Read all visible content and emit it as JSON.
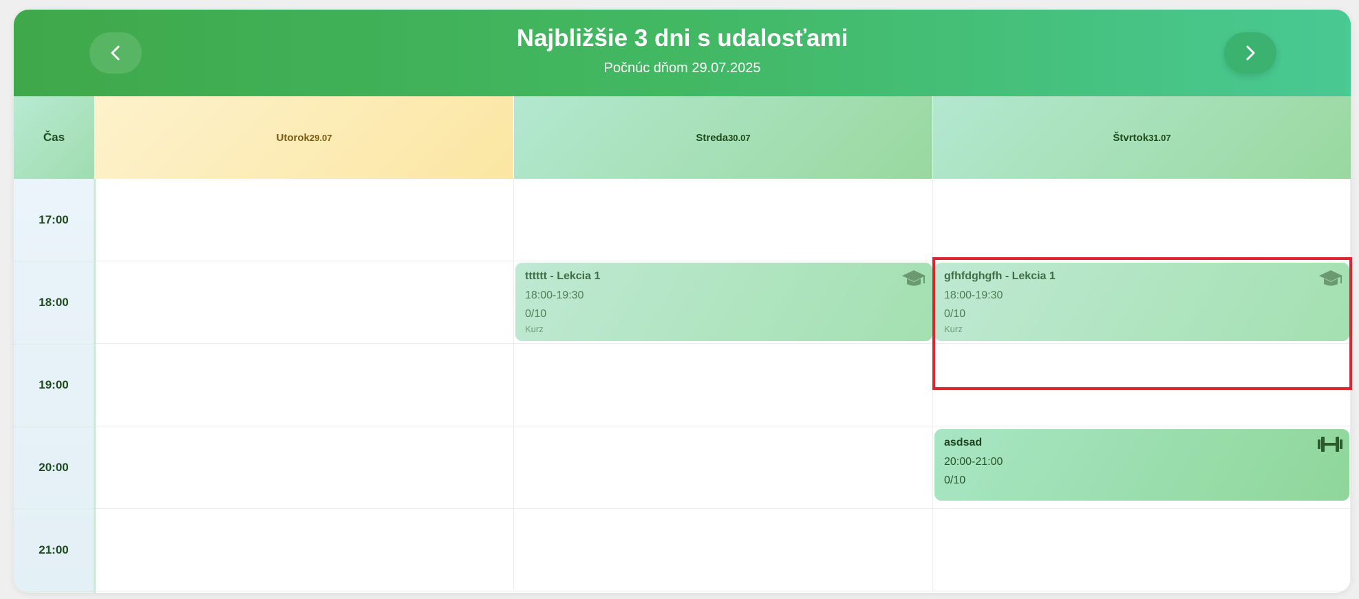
{
  "header": {
    "title": "Najbližšie 3 dni s udalosťami",
    "subtitle": "Počnúc dňom 29.07.2025",
    "prev_icon": "chevron-left-icon",
    "next_icon": "chevron-right-icon"
  },
  "columns": {
    "time_label": "Čas",
    "days": [
      {
        "name": "Utorok",
        "date": "29.07"
      },
      {
        "name": "Streda",
        "date": "30.07"
      },
      {
        "name": "Štvrtok",
        "date": "31.07"
      }
    ]
  },
  "times": [
    "17:00",
    "18:00",
    "19:00",
    "20:00",
    "21:00"
  ],
  "events": [
    {
      "title": "tttttt - Lekcia 1",
      "time": "18:00-19:30",
      "capacity": "0/10",
      "type": "Kurz",
      "icon": "graduation-cap-icon"
    },
    {
      "title": "gfhfdghgfh - Lekcia 1",
      "time": "18:00-19:30",
      "capacity": "0/10",
      "type": "Kurz",
      "icon": "graduation-cap-icon"
    },
    {
      "title": "asdsad",
      "time": "20:00-21:00",
      "capacity": "0/10",
      "icon": "dumbbell-icon"
    }
  ],
  "colors": {
    "header_start": "#3fa84a",
    "header_end": "#49c993",
    "highlight": "#e0242e"
  }
}
